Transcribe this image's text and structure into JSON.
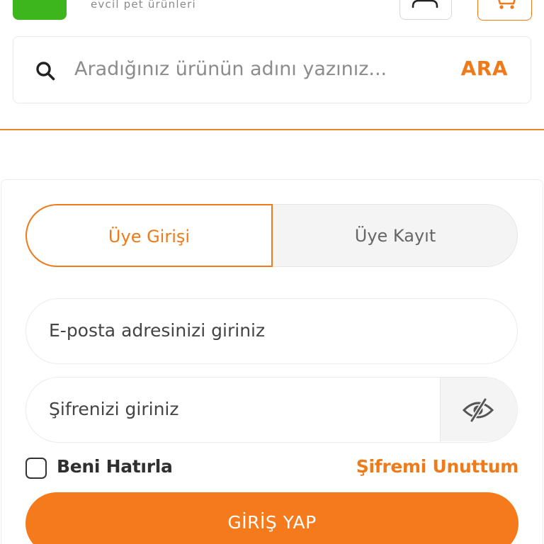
{
  "header": {
    "tagline": "evcil pet ürünleri",
    "logo_icon": "brand-logo",
    "user_icon": "user-icon",
    "cart_icon": "cart-icon"
  },
  "search": {
    "placeholder": "Aradığınız ürünün adını yazınız...",
    "button_label": "ARA",
    "icon": "search-icon"
  },
  "login": {
    "tabs": [
      {
        "label": "Üye Girişi",
        "active": true
      },
      {
        "label": "Üye Kayıt",
        "active": false
      }
    ],
    "email_placeholder": "E-posta adresinizi giriniz",
    "password_placeholder": "Şifrenizi giriniz",
    "password_toggle_icon": "eye-slash-icon",
    "remember_label": "Beni Hatırla",
    "remember_checked": false,
    "forgot_label": "Şifremi Unuttum",
    "submit_label": "GİRİŞ YAP"
  },
  "colors": {
    "accent": "#f47a1c",
    "brand_green": "#3db51c",
    "text": "#444444",
    "muted": "#8c8c8c"
  }
}
